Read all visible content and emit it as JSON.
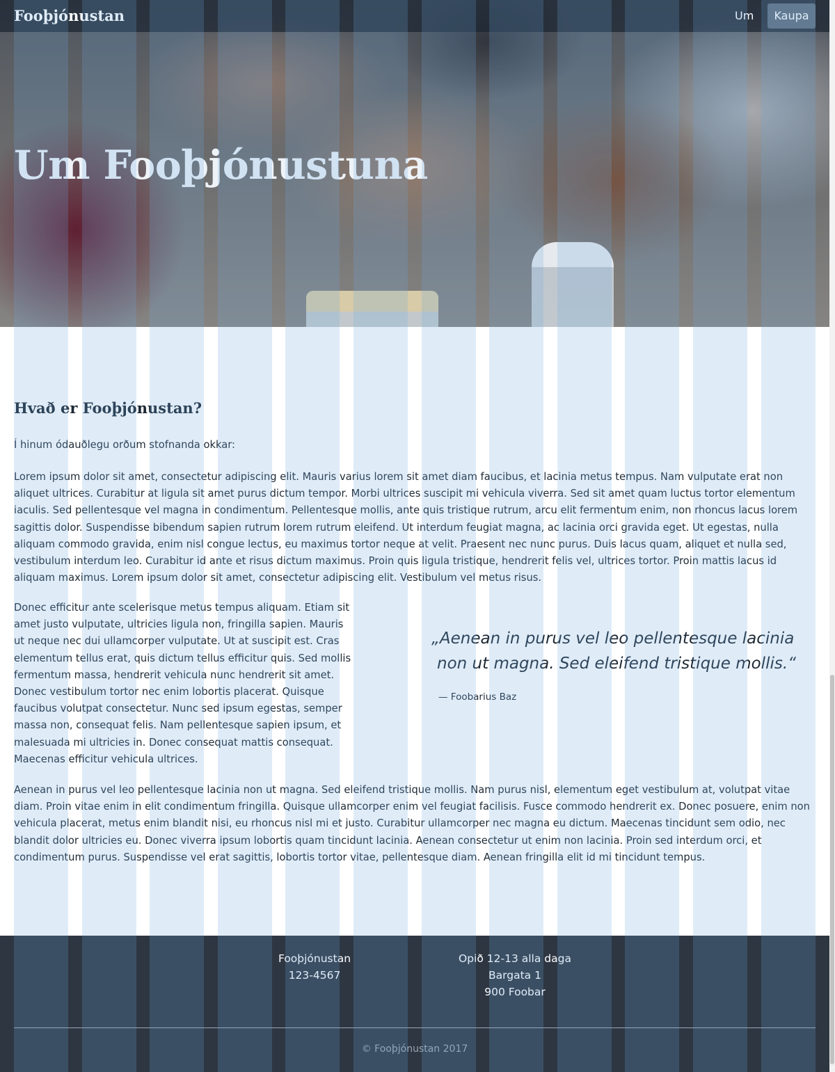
{
  "nav": {
    "brand": "Fooþjónustan",
    "links": [
      "Um",
      "Kaupa"
    ],
    "active": "Kaupa"
  },
  "hero": {
    "title": "Um Fooþjónustuna"
  },
  "content": {
    "heading": "Hvað er Fooþjónustan?",
    "intro": "Í hinum ódauðlegu orðum stofnanda okkar:",
    "paragraph1": "Lorem ipsum dolor sit amet, consectetur adipiscing elit. Mauris varius lorem sit amet diam faucibus, et lacinia metus tempus. Nam vulputate erat non aliquet ultrices. Curabitur at ligula sit amet purus dictum tempor. Morbi ultrices suscipit mi vehicula viverra. Sed sit amet quam luctus tortor elementum iaculis. Sed pellentesque vel magna in condimentum. Pellentesque mollis, ante quis tristique rutrum, arcu elit fermentum enim, non rhoncus lacus lorem sagittis dolor. Suspendisse bibendum sapien rutrum lorem rutrum eleifend. Ut interdum feugiat magna, ac lacinia orci gravida eget. Ut egestas, nulla aliquam commodo gravida, enim nisl congue lectus, eu maximus tortor neque at velit. Praesent nec nunc purus. Duis lacus quam, aliquet et nulla sed, vestibulum interdum leo. Curabitur id ante et risus dictum maximus. Proin quis ligula tristique, hendrerit felis vel, ultrices tortor. Proin mattis lacus id aliquam maximus. Lorem ipsum dolor sit amet, consectetur adipiscing elit. Vestibulum vel metus risus.",
    "paragraph2": "Donec efficitur ante scelerisque metus tempus aliquam. Etiam sit amet justo vulputate, ultricies ligula non, fringilla sapien. Mauris ut neque nec dui ullamcorper vulputate. Ut at suscipit est. Cras elementum tellus erat, quis dictum tellus efficitur quis. Sed mollis fermentum massa, hendrerit vehicula nunc hendrerit sit amet. Donec vestibulum tortor nec enim lobortis placerat. Quisque faucibus volutpat consectetur. Nunc sed ipsum egestas, semper massa non, consequat felis. Nam pellentesque sapien ipsum, et malesuada mi ultricies in. Donec consequat mattis consequat. Maecenas efficitur vehicula ultrices.",
    "quote": "„Aenean in purus vel leo pellentesque lacinia non ut magna. Sed eleifend tristique mollis.“",
    "quote_author": "— Foobarius Baz",
    "paragraph3": "Aenean in purus vel leo pellentesque lacinia non ut magna. Sed eleifend tristique mollis. Nam purus nisl, elementum eget vestibulum at, volutpat vitae diam. Proin vitae enim in elit condimentum fringilla. Quisque ullamcorper enim vel feugiat facilisis. Fusce commodo hendrerit ex. Donec posuere, enim non vehicula placerat, metus enim blandit nisi, eu rhoncus nisl mi et justo. Curabitur ullamcorper nec magna eu dictum. Maecenas tincidunt sem odio, nec blandit dolor ultricies eu. Donec viverra ipsum lobortis quam tincidunt lacinia. Aenean consectetur ut enim non lacinia. Proin sed interdum orci, et condimentum purus. Suspendisse vel erat sagittis, lobortis tortor vitae, pellentesque diam. Aenean fringilla elit id mi tincidunt tempus."
  },
  "footer": {
    "company": "Fooþjónustan",
    "phone": "123-4567",
    "hours": "Opið 12-13 alla daga",
    "street": "Bargata 1",
    "city": "900 Foobar",
    "copyright": "© Fooþjónustan 2017"
  },
  "colors": {
    "navbar": "#1a2430",
    "footer": "#2e3642",
    "grid_overlay": "#6eaae1",
    "text": "#1e2a36"
  }
}
